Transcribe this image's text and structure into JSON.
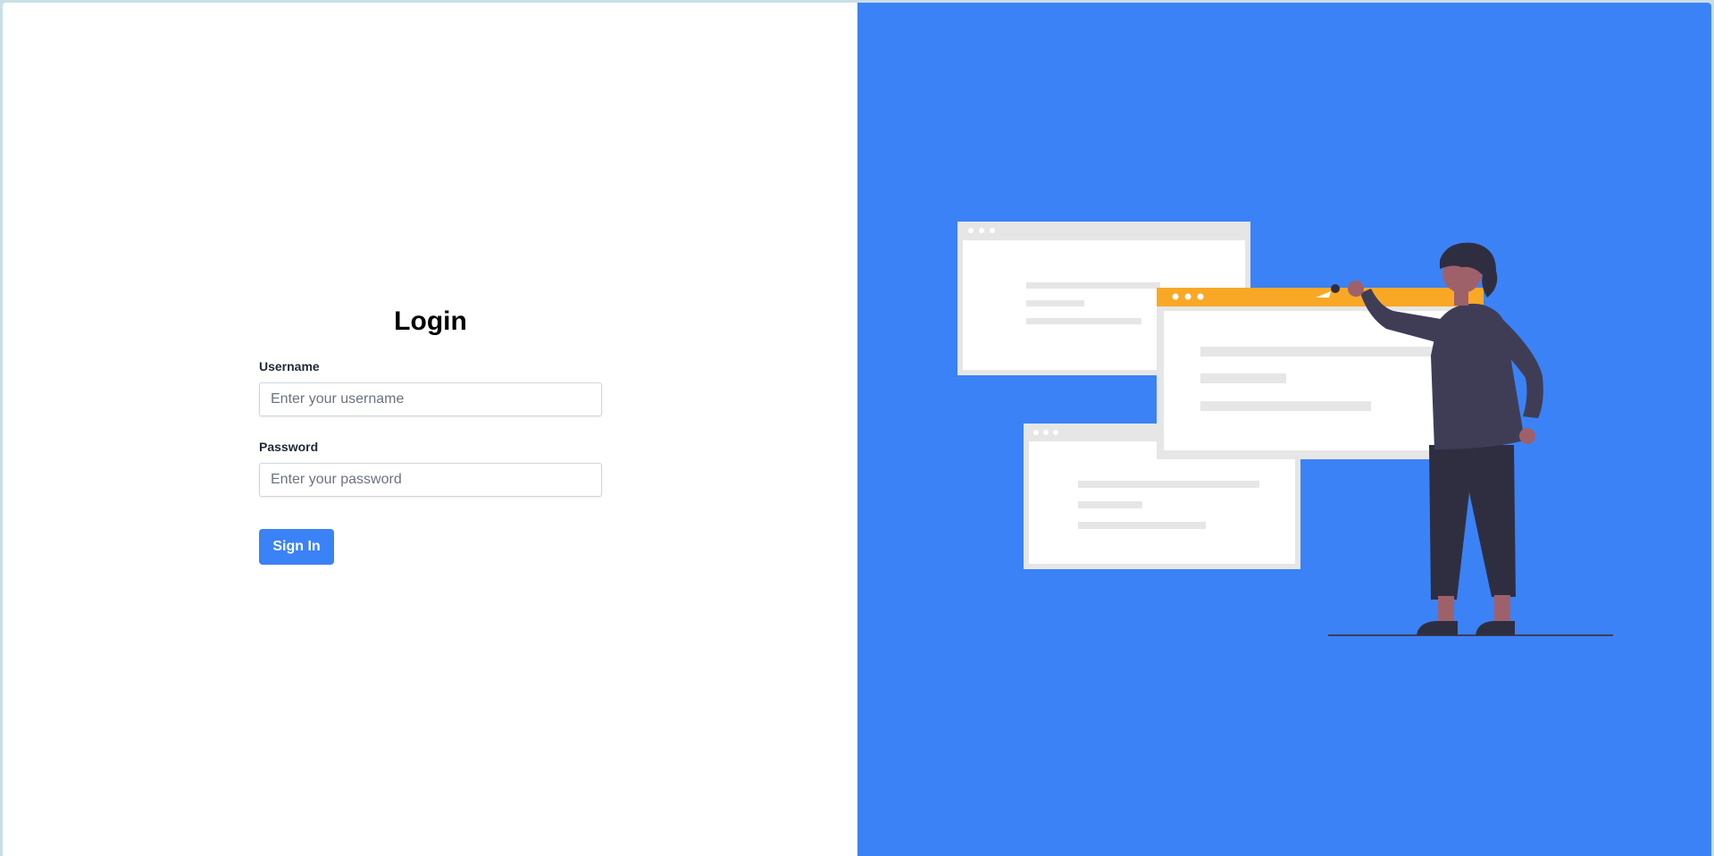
{
  "login": {
    "title": "Login",
    "username_label": "Username",
    "username_placeholder": "Enter your username",
    "username_value": "",
    "password_label": "Password",
    "password_placeholder": "Enter your password",
    "password_value": "",
    "submit_label": "Sign In"
  },
  "colors": {
    "accent": "#3b82f6",
    "panel_background": "#3b82f6",
    "highlight_window": "#f9a826",
    "figure_dark": "#3f3d56",
    "figure_skin": "#9e616a"
  },
  "illustration": {
    "name": "person-pinning-browser-windows-illustration"
  }
}
